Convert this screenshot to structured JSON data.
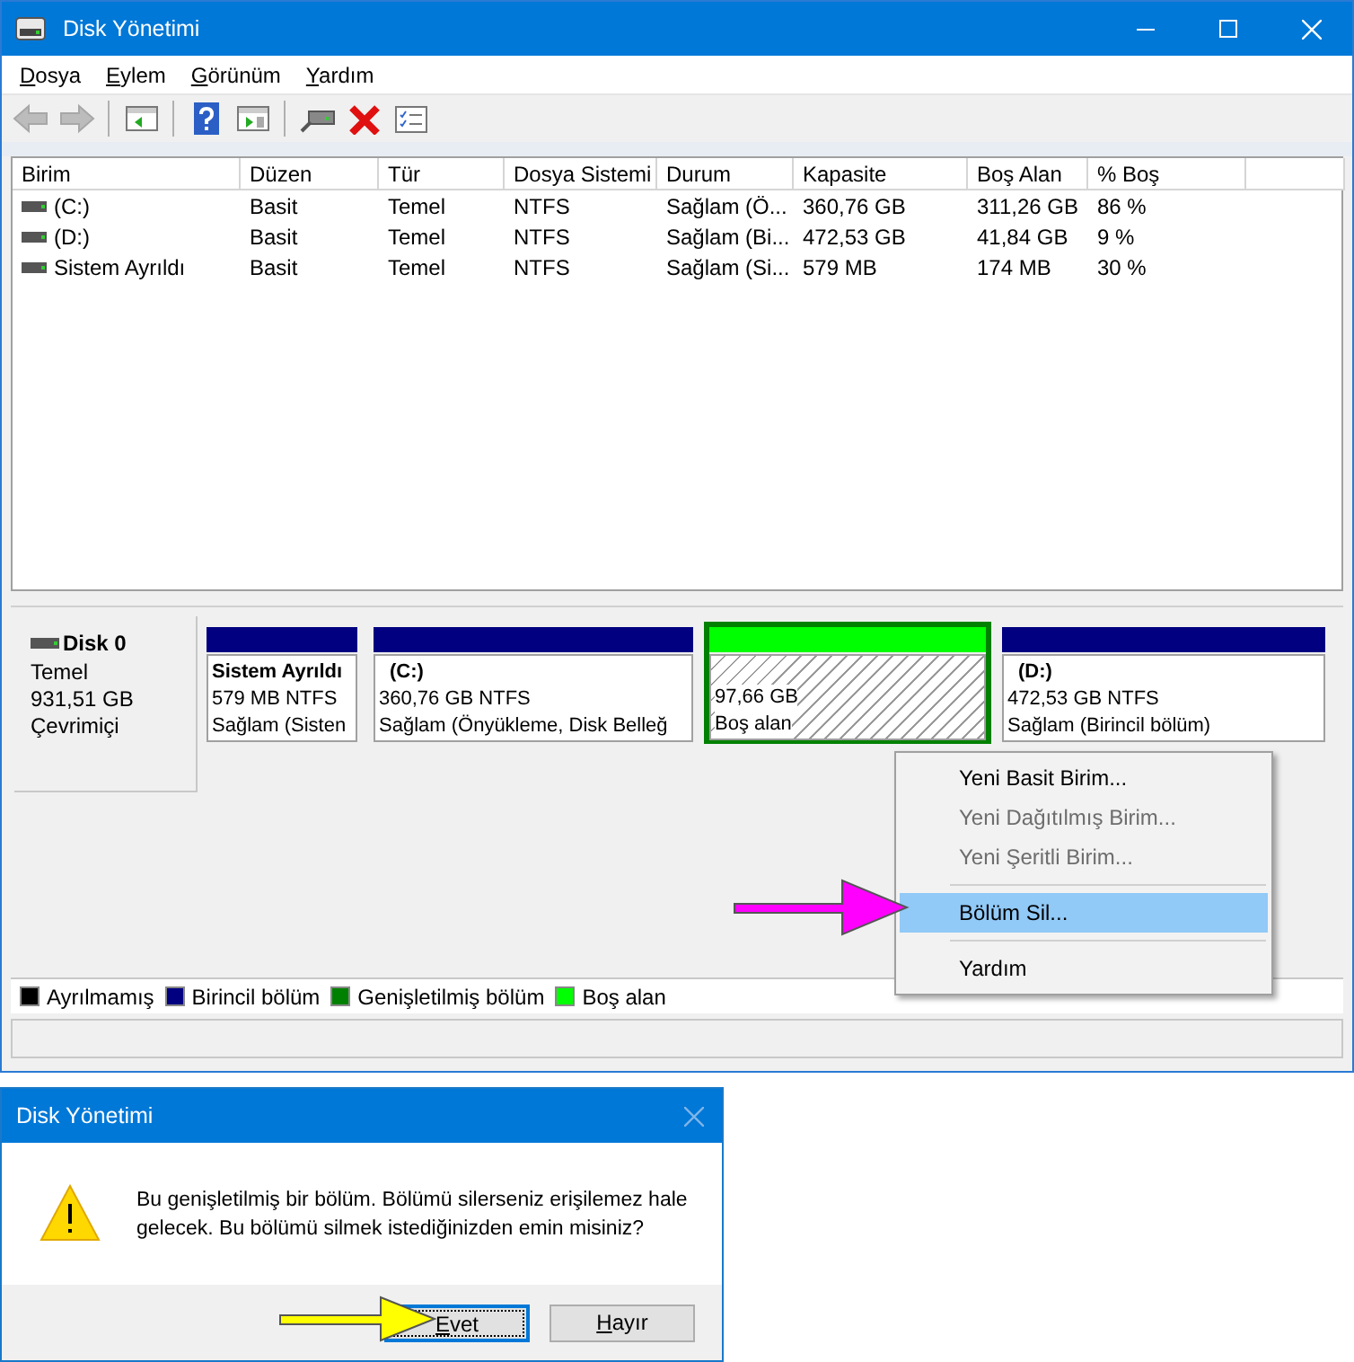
{
  "window": {
    "title": "Disk Yönetimi"
  },
  "menu": [
    {
      "label": "Dosya"
    },
    {
      "label": "Eylem"
    },
    {
      "label": "Görünüm"
    },
    {
      "label": "Yardım"
    }
  ],
  "toolbar": [
    {
      "kind": "back",
      "disabled": true
    },
    {
      "kind": "forward",
      "disabled": true
    },
    {
      "kind": "separator",
      "disabled": false
    },
    {
      "kind": "tree",
      "disabled": false
    },
    {
      "kind": "separator",
      "disabled": false
    },
    {
      "kind": "help",
      "disabled": false
    },
    {
      "kind": "pane",
      "disabled": false
    },
    {
      "kind": "separator",
      "disabled": false
    },
    {
      "kind": "connect",
      "disabled": false
    },
    {
      "kind": "delete",
      "disabled": false
    },
    {
      "kind": "properties",
      "disabled": false
    }
  ],
  "volumes": {
    "columns": [
      "Birim",
      "Düzen",
      "Tür",
      "Dosya Sistemi",
      "Durum",
      "Kapasite",
      "Boş Alan",
      "% Boş"
    ],
    "rows": [
      {
        "cells": [
          "(C:)",
          "Basit",
          "Temel",
          "NTFS",
          "Sağlam (Ö...",
          "360,76 GB",
          "311,26 GB",
          "86 %"
        ]
      },
      {
        "cells": [
          "(D:)",
          "Basit",
          "Temel",
          "NTFS",
          "Sağlam (Bi...",
          "472,53 GB",
          "41,84 GB",
          "9 %"
        ]
      },
      {
        "cells": [
          "Sistem Ayrıldı",
          "Basit",
          "Temel",
          "NTFS",
          "Sağlam (Si...",
          "579 MB",
          "174 MB",
          "30 %"
        ]
      }
    ]
  },
  "disk": {
    "name": "Disk 0",
    "type": "Temel",
    "size": "931,51 GB",
    "status": "Çevrimiçi",
    "partitions": [
      {
        "kind": "primary",
        "title": "Sistem Ayrıldı",
        "size": "579 MB NTFS",
        "status": "Sağlam (Sisten",
        "selected": false,
        "color": "#000080"
      },
      {
        "kind": "primary",
        "title": "(C:)",
        "size": "360,76 GB NTFS",
        "status": "Sağlam (Önyükleme, Disk Belleğ",
        "selected": false,
        "color": "#000080"
      },
      {
        "kind": "free",
        "size": "97,66 GB",
        "status": "Boş alan",
        "selected": true,
        "color": "#00ff00"
      },
      {
        "kind": "primary",
        "title": "(D:)",
        "size": "472,53 GB NTFS",
        "status": "Sağlam (Birincil bölüm)",
        "selected": false,
        "color": "#000080"
      }
    ]
  },
  "legend": [
    {
      "label": "Ayrılmamış",
      "color": "#000000"
    },
    {
      "label": "Birincil bölüm",
      "color": "#000080"
    },
    {
      "label": "Genişletilmiş bölüm",
      "color": "#008000"
    },
    {
      "label": "Boş alan",
      "color": "#00ff00"
    }
  ],
  "context_menu": {
    "items": [
      {
        "kind": "item",
        "label": "Yeni Basit Birim...",
        "disabled": false,
        "selected": false
      },
      {
        "kind": "item",
        "label": "Yeni Dağıtılmış Birim...",
        "disabled": true,
        "selected": false
      },
      {
        "kind": "item",
        "label": "Yeni Şeritli Birim...",
        "disabled": true,
        "selected": false
      },
      {
        "kind": "separator"
      },
      {
        "kind": "item",
        "label": "Bölüm Sil...",
        "disabled": false,
        "selected": true
      },
      {
        "kind": "separator"
      },
      {
        "kind": "item",
        "label": "Yardım",
        "disabled": false,
        "selected": false
      }
    ],
    "pointer_arrow": {
      "color": "#ff00ff"
    }
  },
  "dialog": {
    "title": "Disk Yönetimi",
    "message": "Bu genişletilmiş bir bölüm. Bölümü silerseniz erişilemez hale gelecek. Bu bölümü silmek istediğinizden emin misiniz?",
    "buttons": [
      {
        "label": "Evet",
        "selected": true
      },
      {
        "label": "Hayır",
        "selected": false
      }
    ],
    "pointer_arrow": {
      "color": "#ffff00"
    }
  }
}
